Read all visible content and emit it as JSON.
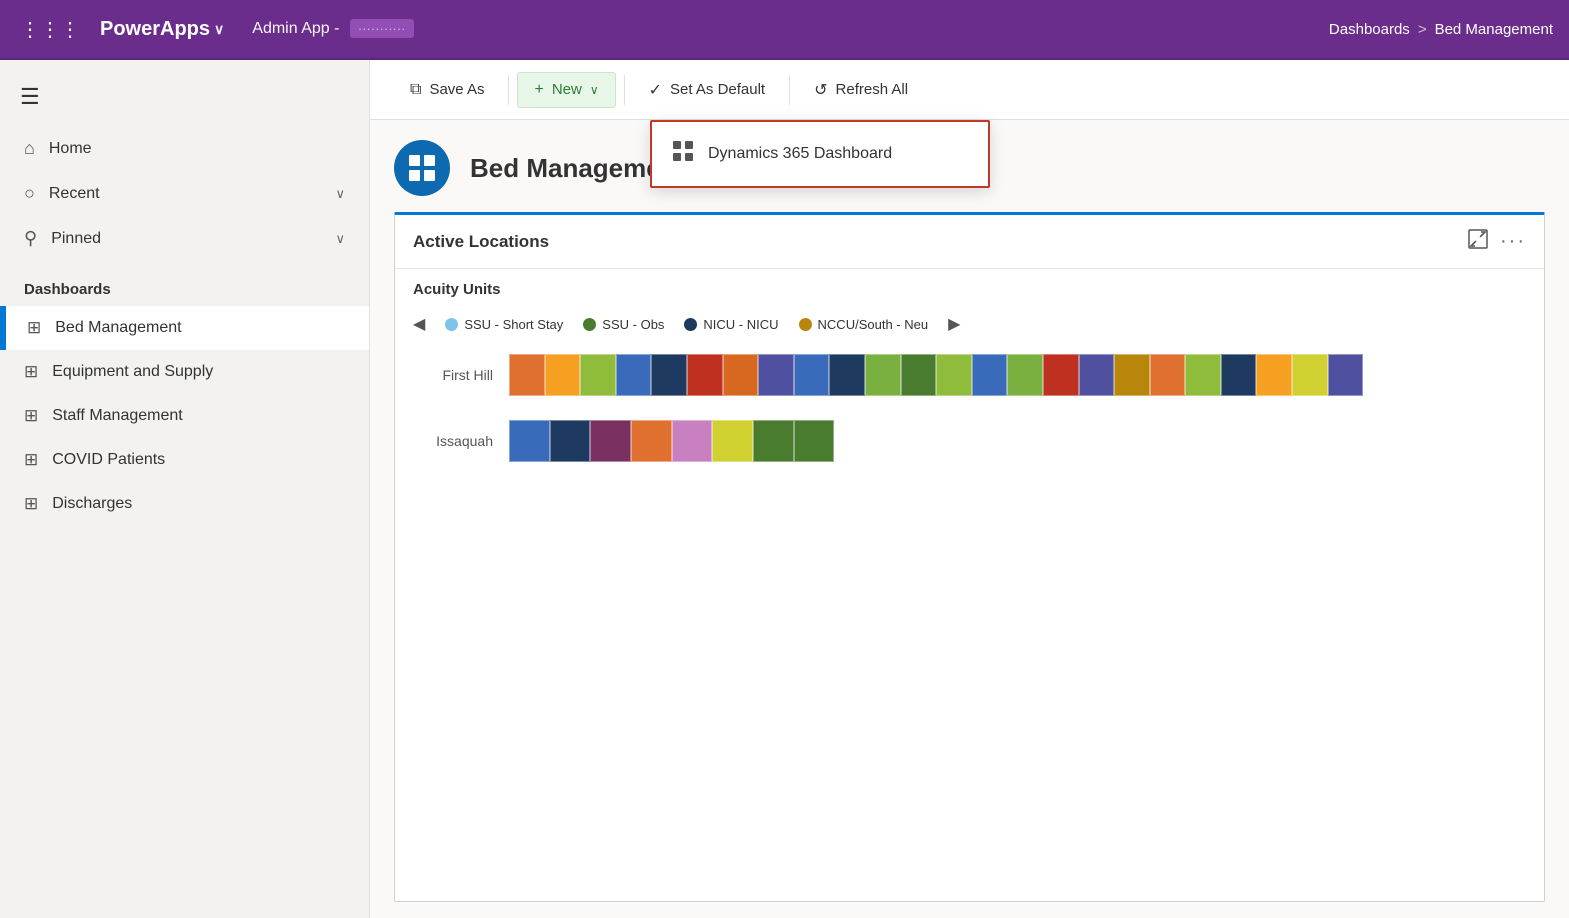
{
  "topNav": {
    "gridIconLabel": "⠿",
    "appTitle": "PowerApps",
    "appChevron": "∨",
    "appName": "Admin App -",
    "appSubName": "···········",
    "breadcrumb": {
      "section": "Dashboards",
      "separator": ">",
      "current": "Bed Management"
    }
  },
  "toolbar": {
    "saveAsLabel": "Save As",
    "saveAsIcon": "⧉",
    "newLabel": "New",
    "newIcon": "+",
    "newChevron": "∨",
    "setDefaultLabel": "Set As Default",
    "setDefaultIcon": "✓",
    "refreshLabel": "Refresh All",
    "refreshIcon": "↺"
  },
  "dropdown": {
    "items": [
      {
        "icon": "⊞",
        "label": "Dynamics 365 Dashboard"
      }
    ]
  },
  "sidebar": {
    "hamburgerIcon": "☰",
    "items": [
      {
        "id": "home",
        "icon": "⌂",
        "label": "Home",
        "hasChevron": false
      },
      {
        "id": "recent",
        "icon": "⊙",
        "label": "Recent",
        "hasChevron": true
      },
      {
        "id": "pinned",
        "icon": "⚲",
        "label": "Pinned",
        "hasChevron": true
      }
    ],
    "dashboardsLabel": "Dashboards",
    "dashboardItems": [
      {
        "id": "bed-management",
        "icon": "⊞",
        "label": "Bed Management",
        "active": true
      },
      {
        "id": "equipment-supply",
        "icon": "⊞",
        "label": "Equipment and Supply",
        "active": false
      },
      {
        "id": "staff-management",
        "icon": "⊞",
        "label": "Staff Management",
        "active": false
      },
      {
        "id": "covid-patients",
        "icon": "⊞",
        "label": "COVID Patients",
        "active": false
      },
      {
        "id": "discharges",
        "icon": "⊞",
        "label": "Discharges",
        "active": false
      }
    ]
  },
  "dashboard": {
    "avatarIcon": "⊞",
    "title": "Bed Management",
    "chart": {
      "title": "Active Locations",
      "subtitle": "Acuity Units",
      "expandIcon": "⤢",
      "moreIcon": "···",
      "legend": [
        {
          "label": "SSU - Short Stay",
          "color": "#7fc4e8"
        },
        {
          "label": "SSU - Obs",
          "color": "#4a7c2f"
        },
        {
          "label": "NICU - NICU",
          "color": "#1e3a5f"
        },
        {
          "label": "NCCU/South - Neu",
          "color": "#b8860b"
        }
      ],
      "rows": [
        {
          "label": "First Hill",
          "segments": [
            {
              "color": "#e07030",
              "width": 3.5
            },
            {
              "color": "#f5a020",
              "width": 3.5
            },
            {
              "color": "#8fbc3a",
              "width": 3.5
            },
            {
              "color": "#3a6bba",
              "width": 3.5
            },
            {
              "color": "#1e3a60",
              "width": 3.5
            },
            {
              "color": "#c03020",
              "width": 3.5
            },
            {
              "color": "#d86820",
              "width": 3.5
            },
            {
              "color": "#5050a0",
              "width": 3.5
            },
            {
              "color": "#3a6bba",
              "width": 3.5
            },
            {
              "color": "#1e3a60",
              "width": 3.5
            },
            {
              "color": "#7ab040",
              "width": 3.5
            },
            {
              "color": "#4a7c2f",
              "width": 3.5
            },
            {
              "color": "#8fbc3a",
              "width": 3.5
            },
            {
              "color": "#3a6bba",
              "width": 3.5
            },
            {
              "color": "#7ab040",
              "width": 3.5
            },
            {
              "color": "#c03020",
              "width": 3.5
            },
            {
              "color": "#5050a0",
              "width": 3.5
            },
            {
              "color": "#b8860b",
              "width": 3.5
            },
            {
              "color": "#e07030",
              "width": 3.5
            },
            {
              "color": "#8fbc3a",
              "width": 3.5
            },
            {
              "color": "#1e3a60",
              "width": 3.5
            },
            {
              "color": "#f5a020",
              "width": 3.5
            },
            {
              "color": "#d0d030",
              "width": 3.5
            },
            {
              "color": "#5050a0",
              "width": 3.5
            }
          ]
        },
        {
          "label": "Issaquah",
          "segments": [
            {
              "color": "#3a6bba",
              "width": 4
            },
            {
              "color": "#1e3a60",
              "width": 4
            },
            {
              "color": "#7a3060",
              "width": 4
            },
            {
              "color": "#e07030",
              "width": 4
            },
            {
              "color": "#c880c0",
              "width": 4
            },
            {
              "color": "#d0d030",
              "width": 4
            },
            {
              "color": "#4a7c2f",
              "width": 4
            },
            {
              "color": "#4a7c2f",
              "width": 4
            }
          ]
        }
      ]
    }
  }
}
